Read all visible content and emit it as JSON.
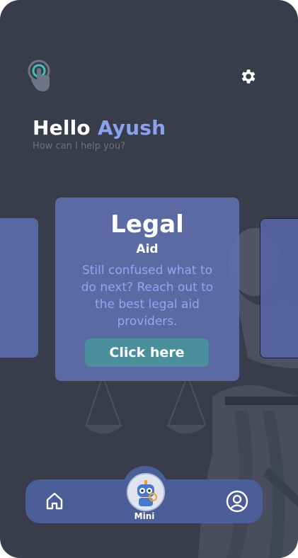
{
  "greeting": {
    "hello": "Hello",
    "name": "Ayush",
    "subtitle": "How can I help you?"
  },
  "header": {
    "left_icon": "touch-hand-icon",
    "right_icon": "gear-icon"
  },
  "card": {
    "title": "Legal",
    "subtitle": "Aid",
    "description": "Still confused what to do next? Reach out to the best legal aid providers.",
    "button_label": "Click here"
  },
  "nav": {
    "home_icon": "home-icon",
    "profile_icon": "user-circle-icon",
    "mini_label": "Mini",
    "mini_icon": "robot-avatar-icon"
  },
  "colors": {
    "background": "#383c4b",
    "card": "#5e6faa",
    "accent_name": "#8aa2ee",
    "cta": "#4b8e9c",
    "nav": "#4c5e98"
  }
}
